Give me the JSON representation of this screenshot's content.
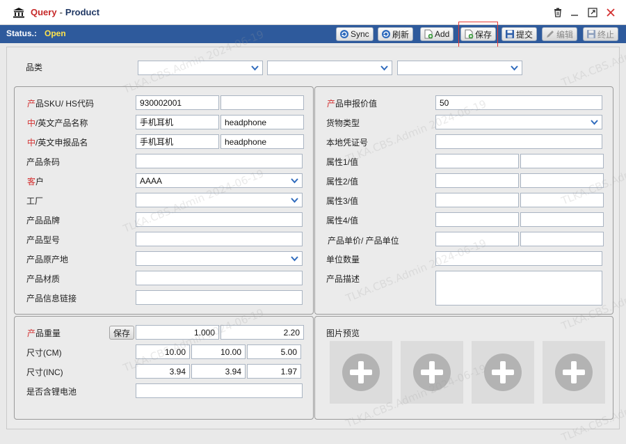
{
  "window": {
    "title_query": "Query",
    "title_separator": "-",
    "title_product": "Product",
    "controls": [
      "trash-icon",
      "minimize-icon",
      "maximize-icon",
      "close-icon"
    ]
  },
  "status": {
    "label": "Status.:",
    "value": "Open"
  },
  "toolbar": {
    "sync": "Sync",
    "refresh": "刷新",
    "add": "Add",
    "save": "保存",
    "submit": "提交",
    "edit": "编辑",
    "stop": "终止"
  },
  "category": {
    "label": "品类",
    "select1": "",
    "select2": "",
    "select3": ""
  },
  "left_panel": {
    "sku_label_req": "产",
    "sku_label_rest": "品SKU/  HS代码",
    "sku_value": "930002001",
    "hs_value": "",
    "cn_en_name_req": "中",
    "cn_en_name_rest": "/英文产品名称",
    "cn_name": "手机耳机",
    "en_name": "headphone",
    "cn_en_declare_req": "中",
    "cn_en_declare_rest": "/英文申报品名",
    "cn_declare": "手机耳机",
    "en_declare": "headphone",
    "barcode_label": "产品条码",
    "barcode_value": "",
    "customer_label_req": "客",
    "customer_label_rest": "户",
    "customer_value": "AAAA",
    "factory_label": "工厂",
    "factory_value": "",
    "brand_label": "产品品牌",
    "brand_value": "",
    "model_label": "产品型号",
    "model_value": "",
    "origin_label": "产品原产地",
    "origin_value": "",
    "material_label": "产品材质",
    "material_value": "",
    "link_label": "产品信息链接",
    "link_value": ""
  },
  "right_panel": {
    "declare_value_label_req": "产",
    "declare_value_label_rest": "品申报价值",
    "declare_value": "50",
    "goods_type_label": "货物类型",
    "goods_type_value": "",
    "voucher_label": "本地凭证号",
    "voucher_value": "",
    "attr1_label": "属性1/值",
    "attr2_label": "属性2/值",
    "attr3_label": "属性3/值",
    "attr4_label": "属性4/值",
    "unit_price_label": "产品单价/ 产品单位",
    "unit_qty_label": "单位数量",
    "desc_label": "产品描述"
  },
  "weight_panel": {
    "weight_label_req": "产",
    "weight_label_rest": "品重量",
    "save_button": "保存",
    "weight1": "1.000",
    "weight2": "2.20",
    "size_cm_label": "尺寸(CM)",
    "cm": [
      "10.00",
      "10.00",
      "5.00"
    ],
    "size_inc_label": "尺寸(INC)",
    "inc": [
      "3.94",
      "3.94",
      "1.97"
    ],
    "battery_label": "是否含锂电池",
    "battery_value": ""
  },
  "image_panel": {
    "label": "图片预览",
    "slots": 4
  },
  "watermark": "TLKA.CBS.Admin 2024-06-19",
  "colors": {
    "accent": "#2e5a9c",
    "status_value": "#ffe44d",
    "required": "#d32f2f",
    "title_red": "#c62828"
  }
}
